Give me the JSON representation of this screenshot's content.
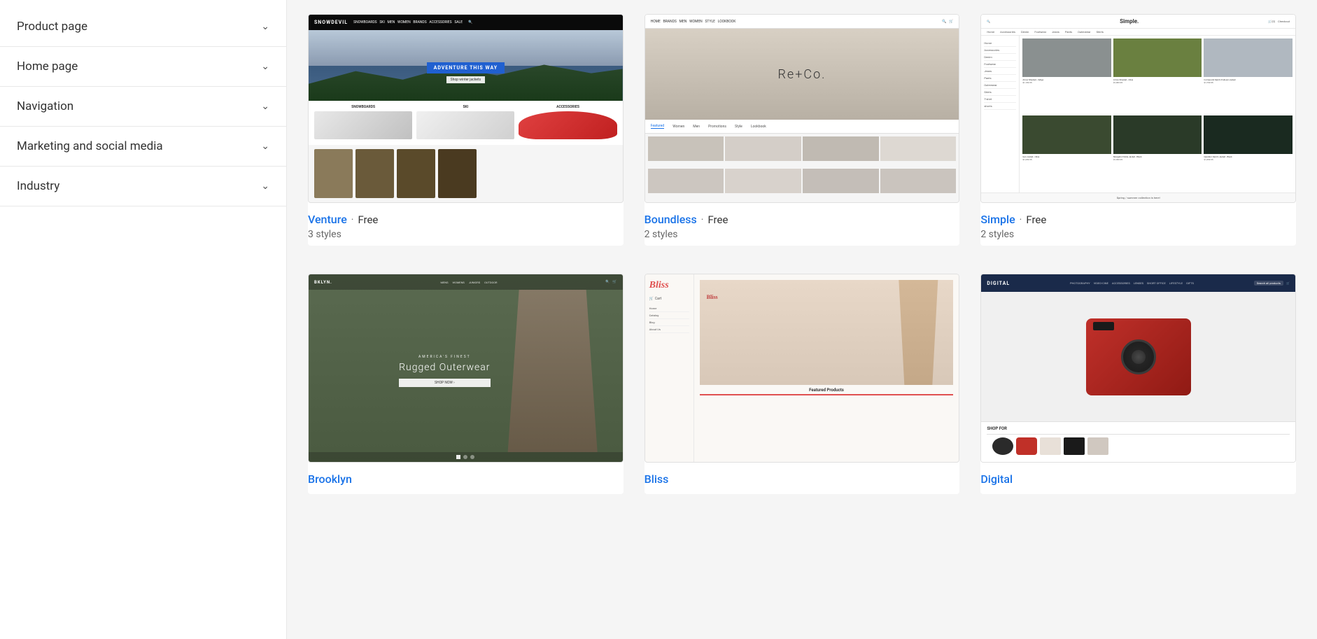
{
  "sidebar": {
    "items": [
      {
        "id": "product-page",
        "label": "Product page",
        "expanded": false
      },
      {
        "id": "home-page",
        "label": "Home page",
        "expanded": false
      },
      {
        "id": "navigation",
        "label": "Navigation",
        "expanded": false
      },
      {
        "id": "marketing-social",
        "label": "Marketing and social media",
        "expanded": false
      },
      {
        "id": "industry",
        "label": "Industry",
        "expanded": false
      }
    ]
  },
  "themes": [
    {
      "id": "venture",
      "name": "Venture",
      "price": "Free",
      "styles": "3 styles",
      "type": "snowboard"
    },
    {
      "id": "boundless",
      "name": "Boundless",
      "price": "Free",
      "styles": "2 styles",
      "type": "fashion"
    },
    {
      "id": "simple",
      "name": "Simple",
      "price": "Free",
      "styles": "2 styles",
      "type": "apparel"
    },
    {
      "id": "brooklyn",
      "name": "Brooklyn",
      "price": "",
      "styles": "",
      "type": "outdoor"
    },
    {
      "id": "bliss",
      "name": "Bliss",
      "price": "",
      "styles": "",
      "type": "beauty"
    },
    {
      "id": "digital",
      "name": "Digital",
      "price": "",
      "styles": "",
      "type": "electronics"
    }
  ],
  "venture": {
    "preview_texts": {
      "cta": "ADVENTURE THIS WAY",
      "col1": "SNOWBOARDS",
      "col2": "SKI",
      "col3": "ACCESSORIES"
    }
  },
  "boundless": {
    "brand": "Re+Co.",
    "tabs": [
      "Featured",
      "Women",
      "Men",
      "Promotions",
      "Style",
      "Lookbook"
    ]
  },
  "simple": {
    "brand": "Simple.",
    "sidebar_items": [
      "Home",
      "Accessories",
      "Denim",
      "Footwear",
      "Jeans",
      "Pants",
      "Outerwear",
      "Shirts",
      "T-shirt",
      "shorts"
    ]
  },
  "brooklyn": {
    "brand": "BKLYN.",
    "sub": "AMERICA'S FINEST",
    "title": "Rugged Outerwear",
    "btn": "SHOP NOW ›"
  },
  "bliss": {
    "brand": "Bliss",
    "menu": [
      "Cart",
      "Home",
      "Catalog",
      "Blog",
      "About Us"
    ],
    "featured": "Featured Products"
  },
  "digital": {
    "brand": "DIGITAL",
    "nav_links": [
      "PHOTOGRAPHY",
      "VIDEO-CINE",
      "ACCESSORIES",
      "LENSES",
      "SHORT OFFICE",
      "LIFESTYLE",
      "GIFTS"
    ],
    "search_placeholder": "Search all products"
  }
}
